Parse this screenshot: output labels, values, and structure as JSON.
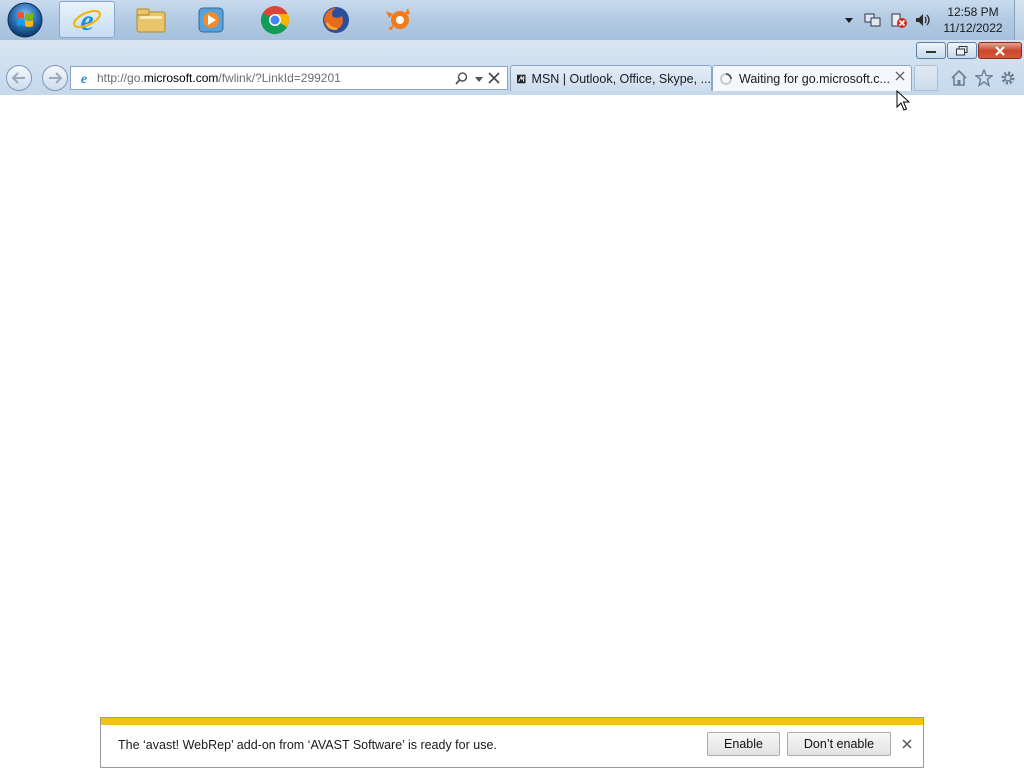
{
  "taskbar": {
    "apps": [
      {
        "name": "Internet Explorer",
        "icon": "ie-icon",
        "active": true
      },
      {
        "name": "Windows Explorer",
        "icon": "folder-icon"
      },
      {
        "name": "Windows Media Player",
        "icon": "media-player-icon"
      },
      {
        "name": "Google Chrome",
        "icon": "chrome-icon"
      },
      {
        "name": "Mozilla Firefox",
        "icon": "firefox-icon"
      },
      {
        "name": "Avast",
        "icon": "avast-icon"
      }
    ],
    "clock": {
      "time": "12:58 PM",
      "date": "11/12/2022"
    }
  },
  "browser": {
    "address": {
      "url_prefix": "http://go.",
      "url_domain": "microsoft.com",
      "url_suffix": "/fwlink/?LinkId=299201"
    },
    "tabs": [
      {
        "label": "MSN | Outlook, Office, Skype, ...",
        "icon": "msn-icon",
        "active": false
      },
      {
        "label": "Waiting for go.microsoft.c...",
        "icon": "loading-icon",
        "active": true
      }
    ]
  },
  "notification": {
    "message": "The ‘avast! WebRep’ add-on from ‘AVAST Software’ is ready for use.",
    "enable_label": "Enable",
    "dont_enable_label": "Don’t enable"
  },
  "colors": {
    "taskbar": "#b3cbe3",
    "notification_stripe": "#f5c117",
    "close_button": "#c9482d"
  }
}
